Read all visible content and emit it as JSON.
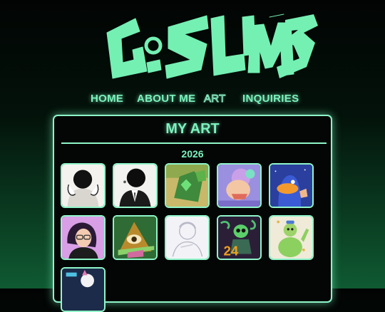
{
  "site": {
    "logo_text": "GOSLIME"
  },
  "nav": {
    "items": [
      "HOME",
      "ABOUT ME",
      "ART",
      "INQUIRIES"
    ],
    "active": "ART"
  },
  "panel": {
    "title": "MY ART",
    "year": "2026"
  },
  "colors": {
    "accent": "#7cf2bd",
    "border": "#8ff5c9",
    "background_top": "#020403",
    "background_bottom": "#0f5a32"
  },
  "gallery": [
    {
      "subject": "dark-orb-head-figure-white-hands"
    },
    {
      "subject": "dark-orb-head-figure-in-suit"
    },
    {
      "subject": "green-gem-creature"
    },
    {
      "subject": "purple-haired-character-with-flower"
    },
    {
      "subject": "blue-duck-thumbs-up"
    },
    {
      "subject": "girl-with-glasses"
    },
    {
      "subject": "eye-pyramid-creature"
    },
    {
      "subject": "white-lineart-figure"
    },
    {
      "subject": "green-alien-with-24"
    },
    {
      "subject": "green-round-creature-waving"
    },
    {
      "subject": "partial-thumbnail"
    }
  ]
}
